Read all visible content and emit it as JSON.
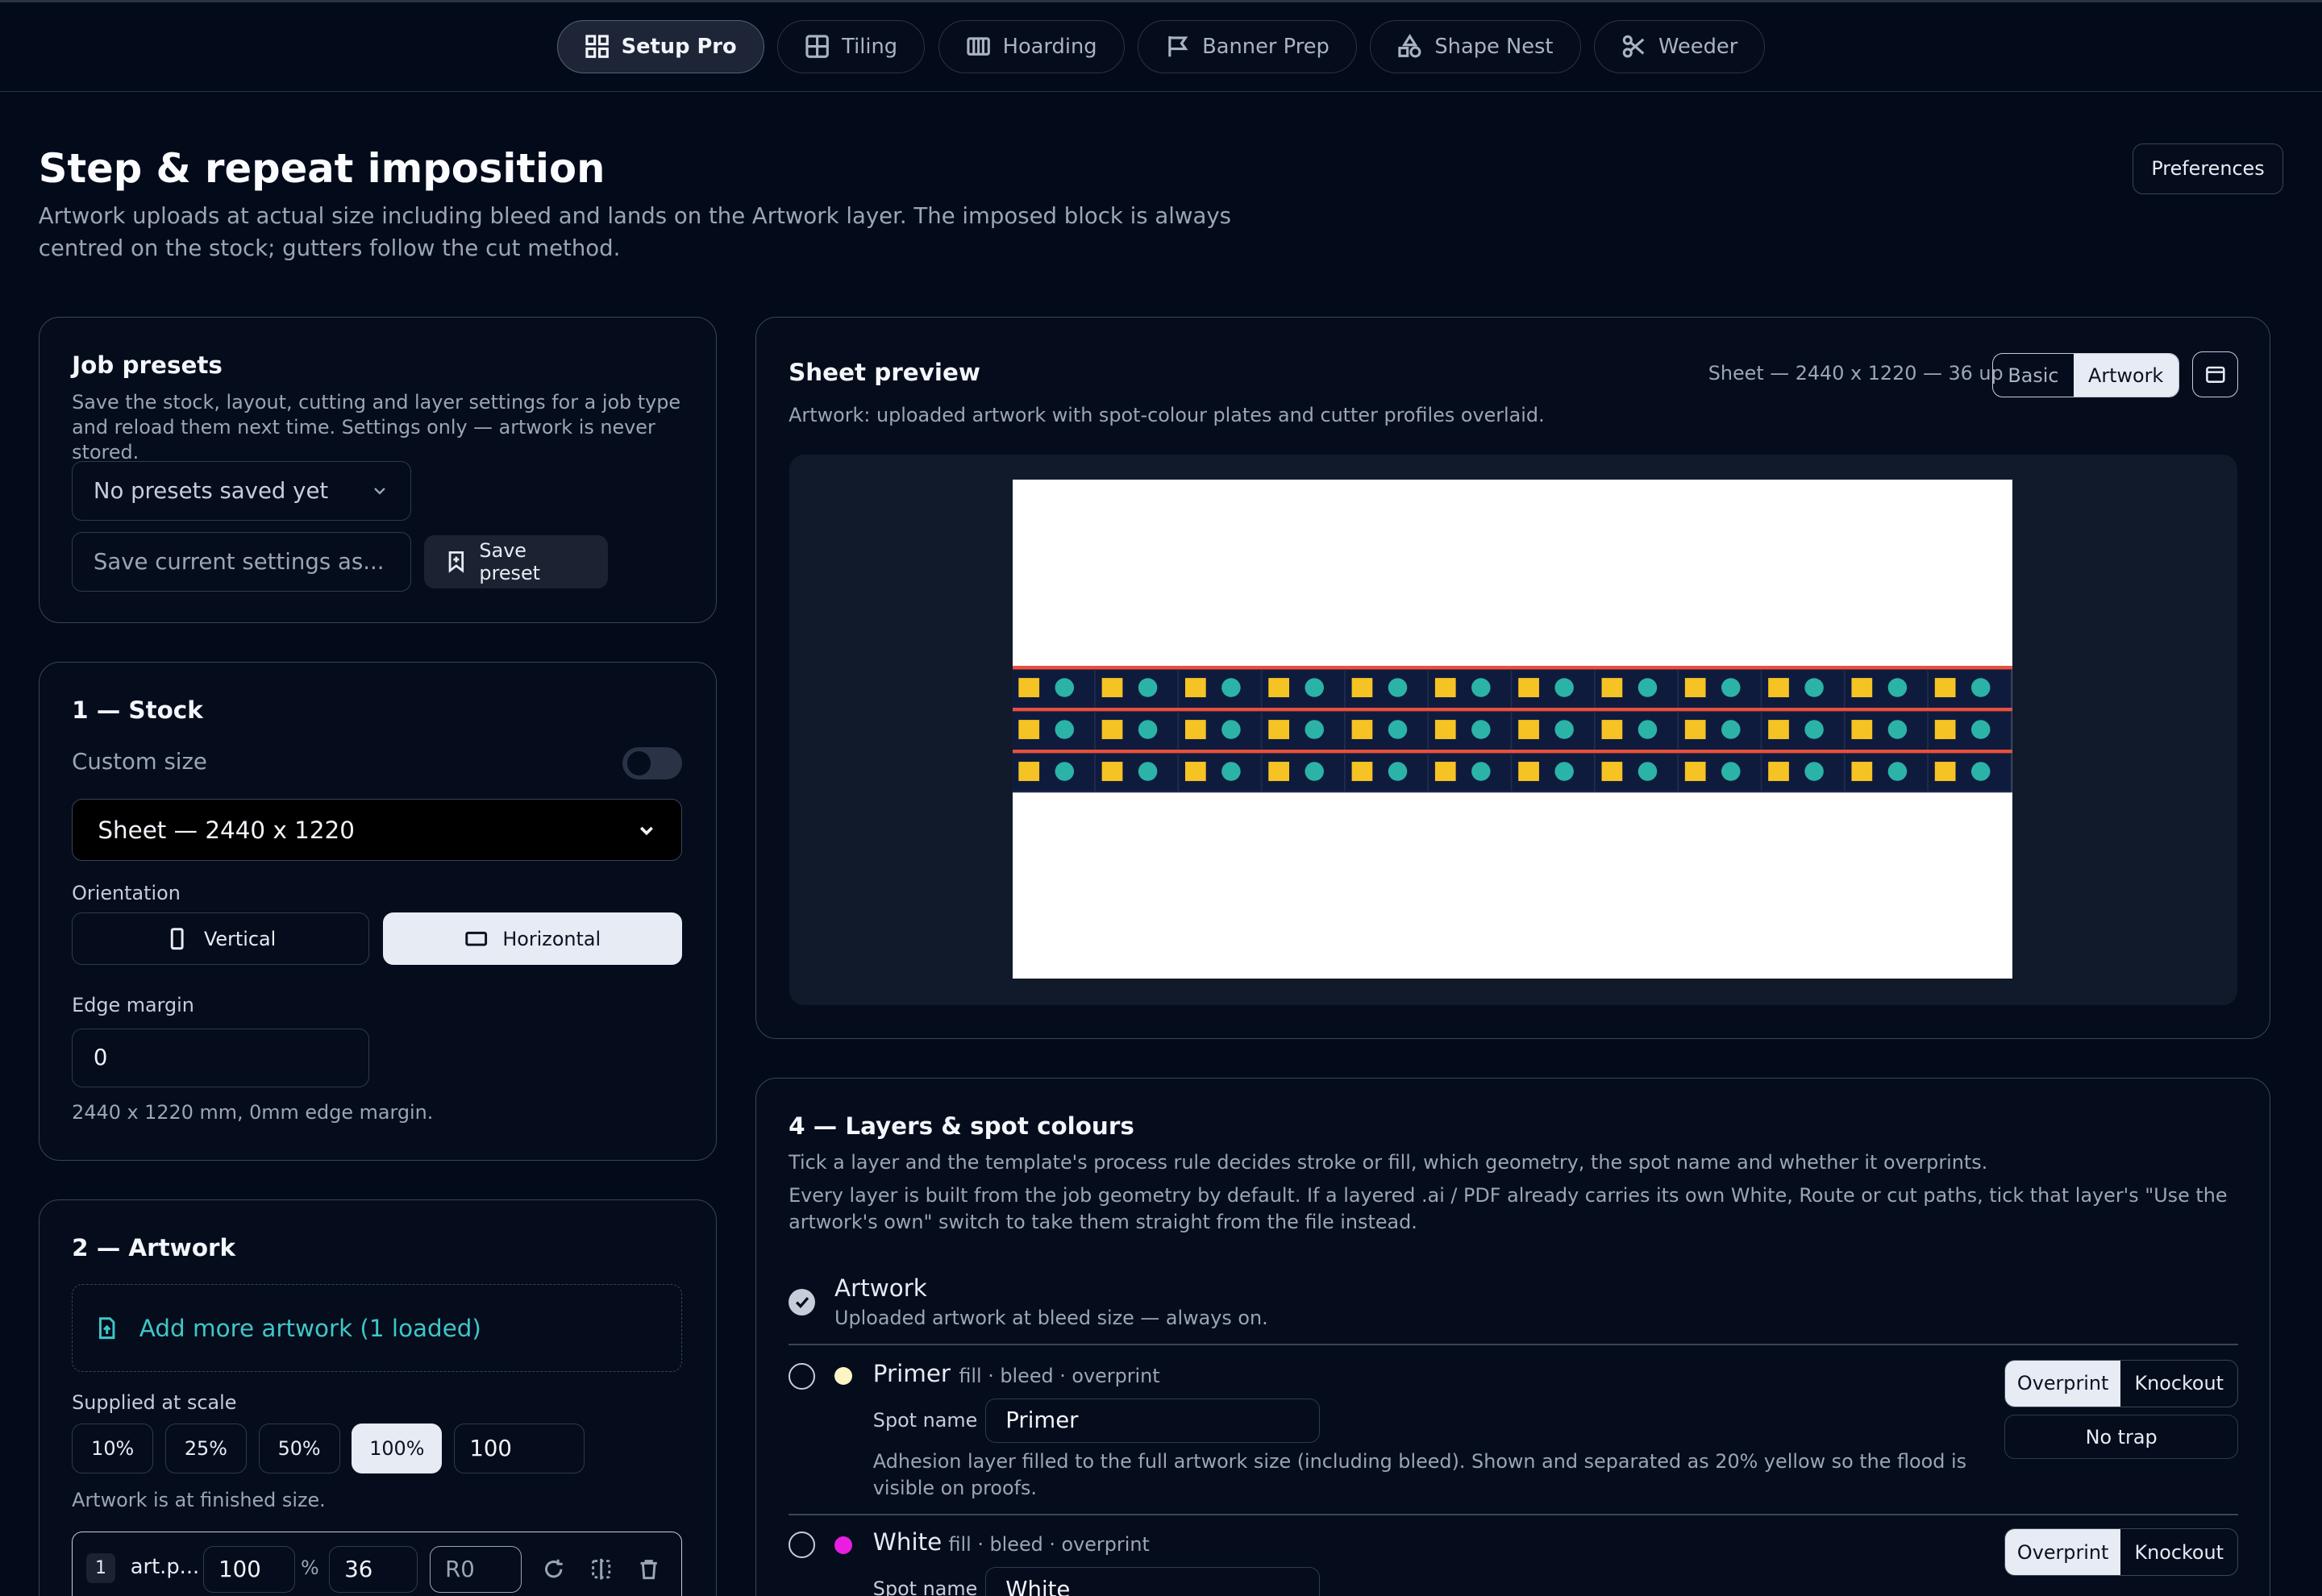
{
  "nav": {
    "tabs": [
      {
        "label": "Setup Pro",
        "icon": "grid-icon",
        "active": true
      },
      {
        "label": "Tiling",
        "icon": "tile-icon",
        "active": false
      },
      {
        "label": "Hoarding",
        "icon": "hoarding-icon",
        "active": false
      },
      {
        "label": "Banner Prep",
        "icon": "flag-icon",
        "active": false
      },
      {
        "label": "Shape Nest",
        "icon": "shapes-icon",
        "active": false
      },
      {
        "label": "Weeder",
        "icon": "scissors-icon",
        "active": false
      }
    ]
  },
  "header": {
    "title": "Step & repeat imposition",
    "subtitle": "Artwork uploads at actual size including bleed and lands on the Artwork layer. The imposed block is always centred on the stock; gutters follow the cut method.",
    "preferences_label": "Preferences"
  },
  "presets": {
    "title": "Job presets",
    "description": "Save the stock, layout, cutting and layer settings for a job type and reload them next time. Settings only — artwork is never stored.",
    "select_value": "No presets saved yet",
    "name_placeholder": "Save current settings as...",
    "save_label": "Save preset"
  },
  "stock": {
    "title": "1 — Stock",
    "custom_size_label": "Custom size",
    "custom_size_on": false,
    "selected": "Sheet — 2440 x 1220",
    "orientation_label": "Orientation",
    "vertical_label": "Vertical",
    "horizontal_label": "Horizontal",
    "orientation": "Horizontal",
    "edge_margin_label": "Edge margin",
    "edge_margin_value": "0",
    "summary": "2440 x 1220 mm, 0mm edge margin."
  },
  "artwork": {
    "title": "2 — Artwork",
    "add_label": "Add more artwork (1 loaded)",
    "scale_label": "Supplied at scale",
    "scales": [
      "10%",
      "25%",
      "50%",
      "100%"
    ],
    "active_scale": "100%",
    "scale_custom": "100",
    "scale_note": "Artwork is at finished size.",
    "file": {
      "index": "1",
      "name": "art.p...",
      "scale": "100",
      "percent_sign": "%",
      "qty": "36",
      "rotation": "R0"
    }
  },
  "preview": {
    "title": "Sheet preview",
    "summary": "Sheet — 2440 x 1220 — 36 up",
    "modes": [
      "Basic",
      "Artwork"
    ],
    "active_mode": "Artwork",
    "description": "Artwork: uploaded artwork with spot-colour plates and cutter profiles overlaid.",
    "grid": {
      "columns": 12,
      "rows": 3
    },
    "colors": {
      "tile_bg": "#0f1b3d",
      "square": "#f6c325",
      "circle": "#2bb3a8",
      "cut_line": "#e8503d"
    }
  },
  "layers": {
    "title": "4 — Layers & spot colours",
    "desc1": "Tick a layer and the template's process rule decides stroke or fill, which geometry, the spot name and whether it overprints.",
    "desc2": "Every layer is built from the job geometry by default. If a layered .ai / PDF already carries its own White, Route or cut paths, tick that layer's \"Use the artwork's own\" switch to take them straight from the file instead.",
    "artwork_layer": {
      "name": "Artwork",
      "note": "Uploaded artwork at bleed size — always on."
    },
    "spot_name_label": "Spot name",
    "overprint_label": "Overprint",
    "knockout_label": "Knockout",
    "no_trap_label": "No trap",
    "primer": {
      "name": "Primer",
      "meta": "fill · bleed · overprint",
      "spot": "Primer",
      "color": "#fdf6c4",
      "description": "Adhesion layer filled to the full artwork size (including bleed). Shown and separated as 20% yellow so the flood is visible on proofs."
    },
    "white": {
      "name": "White",
      "meta": "fill · bleed · overprint",
      "spot": "White",
      "color": "#e91ee0"
    }
  }
}
